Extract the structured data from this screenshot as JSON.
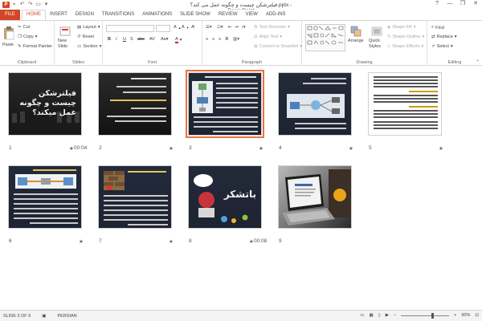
{
  "window": {
    "title": "فیلترشکن چیست و چگونه عمل می کند؟.pptx - PowerPoint",
    "app_icon_letter": "P",
    "controls": [
      "?",
      "—",
      "❐",
      "✕"
    ]
  },
  "ribbon_tabs": {
    "file": "FILE",
    "tabs": [
      "HOME",
      "INSERT",
      "DESIGN",
      "TRANSITIONS",
      "ANIMATIONS",
      "SLIDE SHOW",
      "REVIEW",
      "VIEW",
      "ADD-INS"
    ],
    "active": "HOME",
    "signin": ""
  },
  "ribbon": {
    "clipboard": {
      "label": "Clipboard",
      "paste": "Paste",
      "cut": "Cut",
      "copy": "Copy",
      "format_painter": "Format Painter"
    },
    "slides": {
      "label": "Slides",
      "new_slide": "New Slide",
      "layout": "Layout",
      "reset": "Reset",
      "section": "Section"
    },
    "font": {
      "label": "Font"
    },
    "paragraph": {
      "label": "Paragraph",
      "text_direction": "Text Direction",
      "align_text": "Align Text",
      "convert_smartart": "Convert to SmartArt"
    },
    "drawing": {
      "label": "Drawing",
      "arrange": "Arrange",
      "quick_styles": "Quick Styles",
      "shape_fill": "Shape Fill",
      "shape_outline": "Shape Outline",
      "shape_effects": "Shape Effects"
    },
    "editing": {
      "label": "Editing",
      "find": "Find",
      "replace": "Replace",
      "select": "Select"
    }
  },
  "slides": [
    {
      "num": "1",
      "time": "00:04",
      "star": "★",
      "title": "فیلترشکن چیست و چگونه عمل میکند؟"
    },
    {
      "num": "2",
      "time": "",
      "star": "★"
    },
    {
      "num": "3",
      "time": "",
      "star": "★"
    },
    {
      "num": "4",
      "time": "",
      "star": "★"
    },
    {
      "num": "5",
      "time": "",
      "star": "★"
    },
    {
      "num": "6",
      "time": "",
      "star": "★"
    },
    {
      "num": "7",
      "time": "",
      "star": "★"
    },
    {
      "num": "8",
      "time": "00:08",
      "star": "★",
      "title": "باتشکر"
    },
    {
      "num": "9",
      "time": "",
      "star": ""
    }
  ],
  "status": {
    "slide_info": "SLIDE 3 OF 9",
    "language": "PERSIAN",
    "zoom": "90%"
  }
}
